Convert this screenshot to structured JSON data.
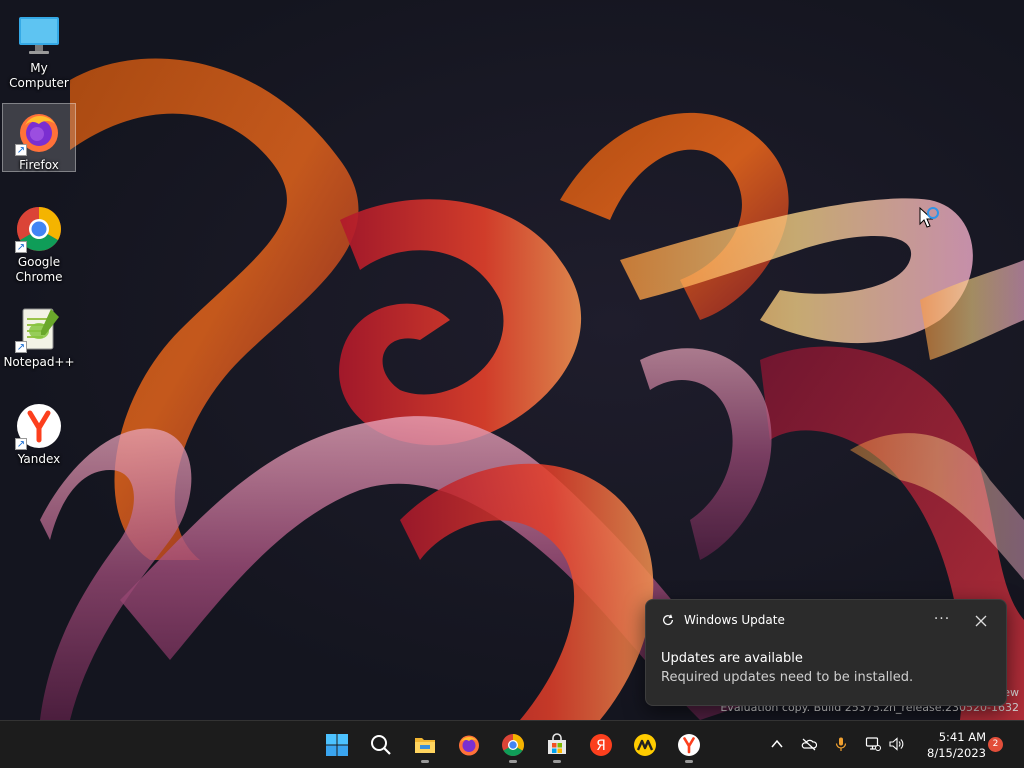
{
  "desktop": {
    "icons": [
      {
        "label": "My Computer",
        "icon": "monitor-icon"
      },
      {
        "label": "Firefox",
        "icon": "firefox-icon"
      },
      {
        "label": "Google\nChrome",
        "icon": "chrome-icon"
      },
      {
        "label": "Notepad++",
        "icon": "notepad-plus-plus-icon"
      },
      {
        "label": "Yandex",
        "icon": "yandex-icon"
      }
    ],
    "watermark": {
      "line1": "ew",
      "line2": "Evaluation copy. Build 25375.zn_release.230520-1632"
    }
  },
  "toast": {
    "app_name": "Windows Update",
    "title": "Updates are available",
    "body": "Required updates need to be installed.",
    "more_label": "···"
  },
  "taskbar": {
    "apps": [
      "start-icon",
      "search-icon",
      "file-explorer-icon",
      "firefox-icon",
      "chrome-icon",
      "microsoft-store-icon",
      "yandex-browser-icon",
      "yandex-music-icon",
      "yandex-icon"
    ],
    "tray_icons": [
      "chevron-up-icon",
      "onedrive-icon",
      "microphone-icon",
      "network-icon",
      "volume-icon"
    ],
    "time": "5:41 AM",
    "date": "8/15/2023",
    "notification_count": "2"
  },
  "colors": {
    "accent": "#0078d4",
    "taskbar": "#1c1c1c",
    "toast_bg": "#2b2b2b",
    "badge": "#e24e3a"
  }
}
